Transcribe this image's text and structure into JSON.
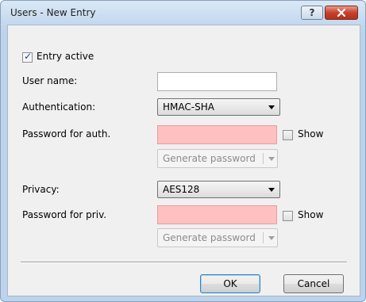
{
  "window": {
    "title": "Users - New Entry",
    "help_label": "?"
  },
  "form": {
    "entry_active": {
      "label": "Entry active",
      "checked": true
    },
    "user_name": {
      "label": "User name:",
      "value": ""
    },
    "authentication": {
      "label": "Authentication:",
      "selected": "HMAC-SHA"
    },
    "password_auth": {
      "label": "Password for auth.",
      "value": "",
      "show_label": "Show",
      "show_checked": false,
      "generate_label": "Generate password"
    },
    "privacy": {
      "label": "Privacy:",
      "selected": "AES128"
    },
    "password_priv": {
      "label": "Password for priv.",
      "value": "",
      "show_label": "Show",
      "show_checked": false,
      "generate_label": "Generate password"
    }
  },
  "buttons": {
    "ok": "OK",
    "cancel": "Cancel"
  },
  "colors": {
    "required_field_bg": "#ffc0c0",
    "close_button": "#c7402a"
  }
}
